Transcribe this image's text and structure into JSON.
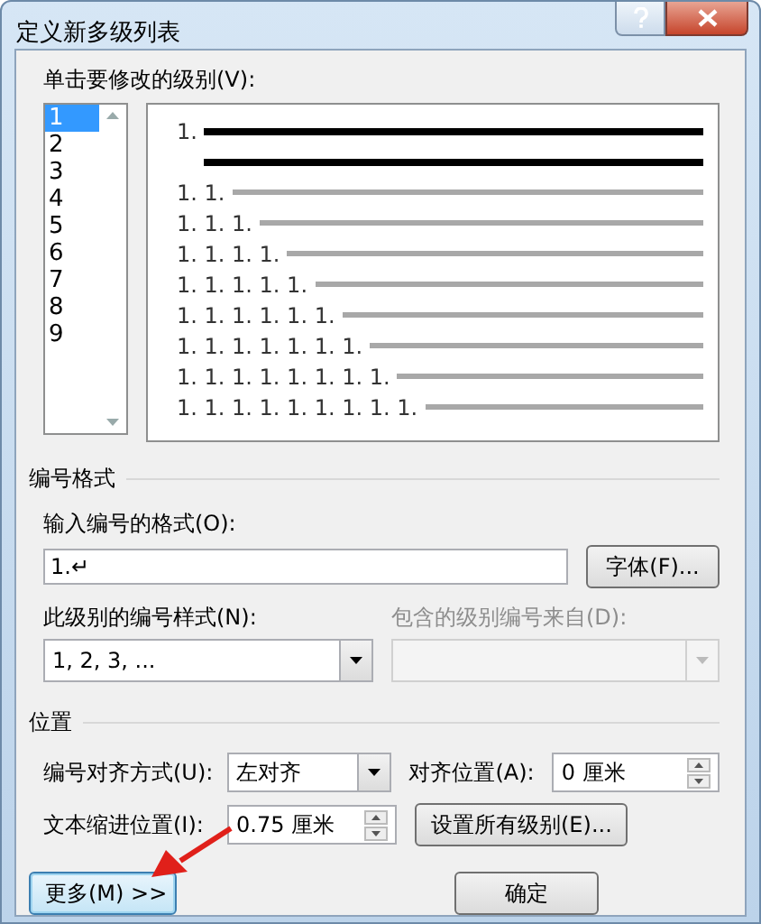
{
  "window": {
    "title": "定义新多级列表"
  },
  "level_label": "单击要修改的级别(V):",
  "levels": [
    {
      "label": "1",
      "selected": true
    },
    {
      "label": "2",
      "selected": false
    },
    {
      "label": "3",
      "selected": false
    },
    {
      "label": "4",
      "selected": false
    },
    {
      "label": "5",
      "selected": false
    },
    {
      "label": "6",
      "selected": false
    },
    {
      "label": "7",
      "selected": false
    },
    {
      "label": "8",
      "selected": false
    },
    {
      "label": "9",
      "selected": false
    }
  ],
  "preview": [
    {
      "number": "1.",
      "selected": true
    },
    {
      "number": "1. 1.",
      "selected": false
    },
    {
      "number": "1. 1. 1.",
      "selected": false
    },
    {
      "number": "1. 1. 1. 1.",
      "selected": false
    },
    {
      "number": "1. 1. 1. 1. 1.",
      "selected": false
    },
    {
      "number": "1. 1. 1. 1. 1. 1.",
      "selected": false
    },
    {
      "number": "1. 1. 1. 1. 1. 1. 1.",
      "selected": false
    },
    {
      "number": "1. 1. 1. 1. 1. 1. 1. 1.",
      "selected": false
    },
    {
      "number": "1. 1. 1. 1. 1. 1. 1. 1. 1.",
      "selected": false
    }
  ],
  "number_format": {
    "title": "编号格式",
    "format_label": "输入编号的格式(O):",
    "format_value": "1.↵",
    "font_button": "字体(F)...",
    "style_label": "此级别的编号样式(N):",
    "style_value": "1, 2, 3, ...",
    "include_label": "包含的级别编号来自(D):",
    "include_disabled": true
  },
  "position": {
    "title": "位置",
    "align_label": "编号对齐方式(U):",
    "align_value": "左对齐",
    "at_label": "对齐位置(A):",
    "at_value": "0 厘米",
    "indent_label": "文本缩进位置(I):",
    "indent_value": "0.75 厘米",
    "set_all_button": "设置所有级别(E)..."
  },
  "buttons": [
    {
      "label": "更多(M) >>",
      "focused": true
    },
    {
      "label": "确定",
      "focused": false
    }
  ]
}
